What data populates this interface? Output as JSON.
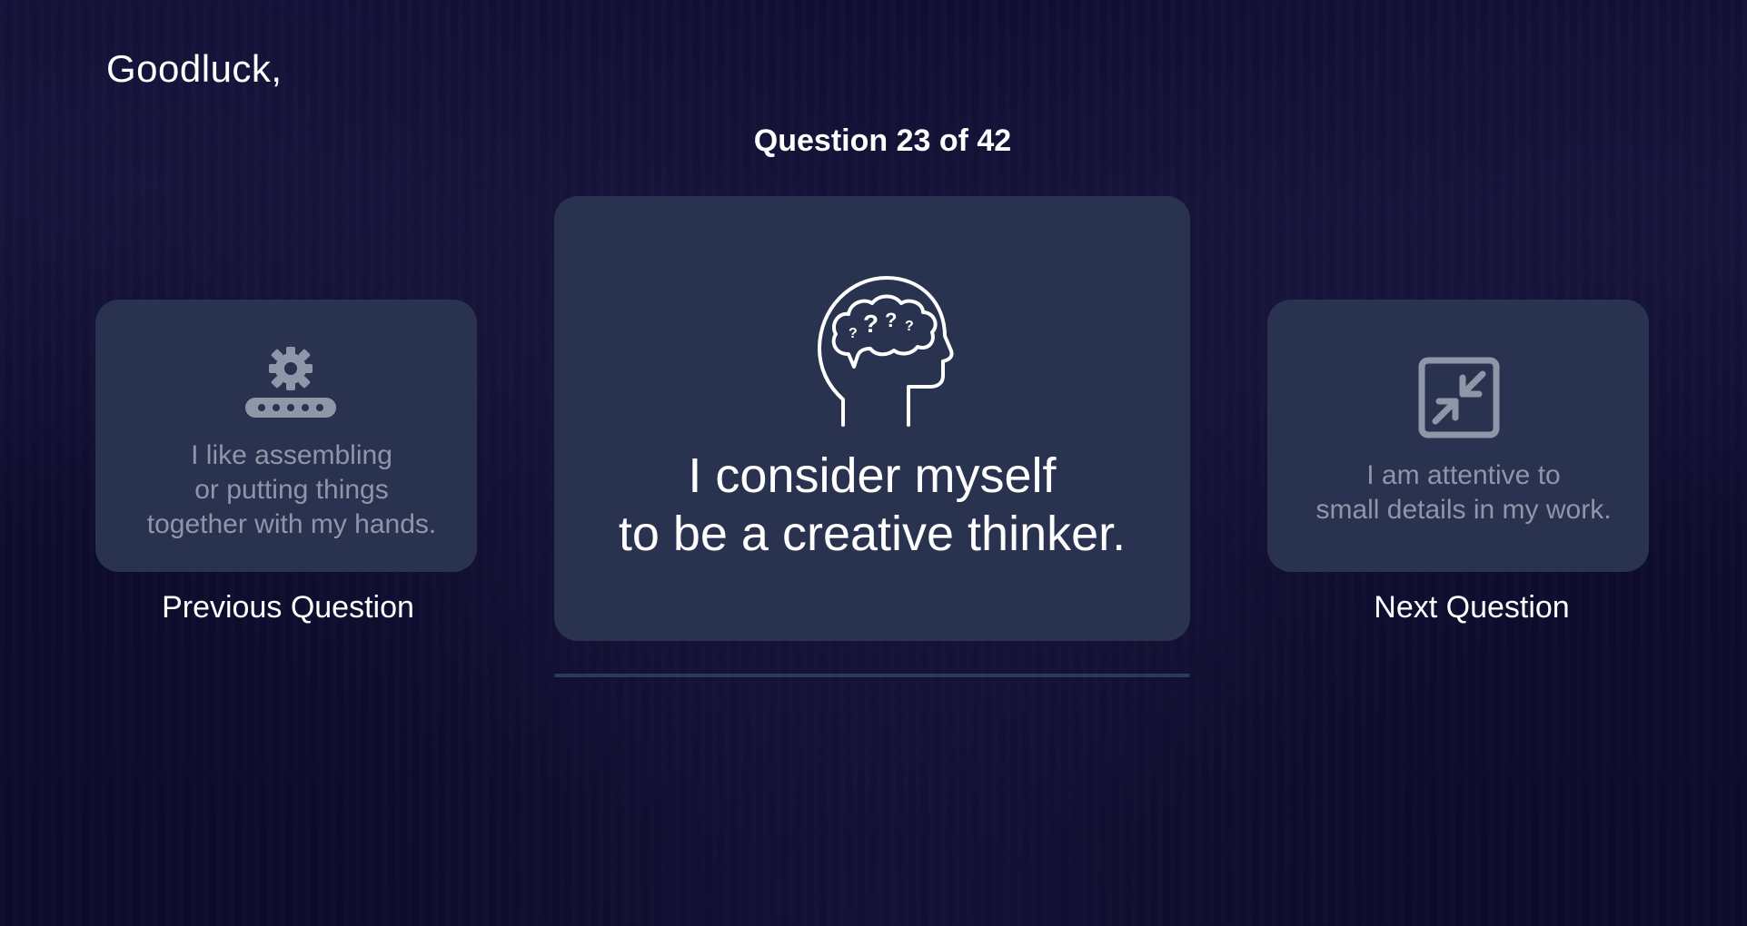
{
  "greeting": "Goodluck,",
  "progress": "Question 23 of 42",
  "previous": {
    "icon": "conveyor-gear-icon",
    "text": "I like assembling\nor putting things\ntogether with my hands.",
    "label": "Previous Question"
  },
  "current": {
    "icon": "head-brain-question-icon",
    "text": "I consider myself\nto be a creative thinker."
  },
  "next": {
    "icon": "minimize-arrows-icon",
    "text": "I am attentive to\nsmall details in my work.",
    "label": "Next Question"
  },
  "colors": {
    "background": "#0f0d2e",
    "card": "#293350",
    "muted_text": "#8f96a8",
    "text": "#ffffff"
  }
}
